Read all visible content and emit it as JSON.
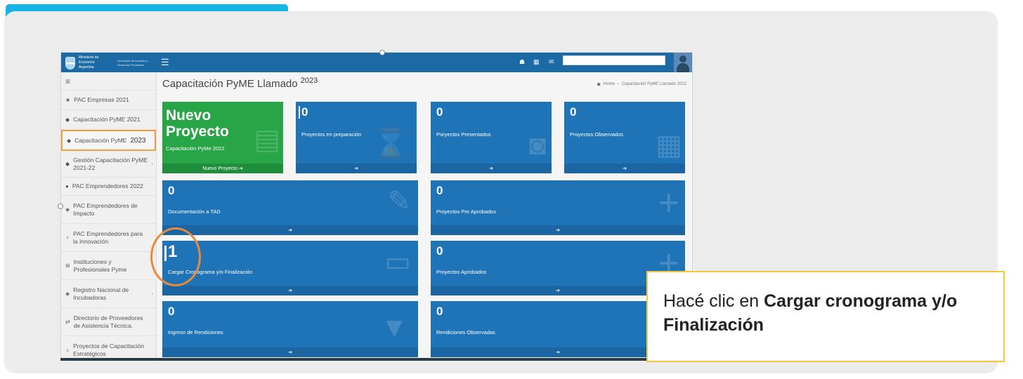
{
  "colors": {
    "accent": "#1ab3e6",
    "tile_blue": "#1f74b8",
    "tile_green": "#27a547",
    "highlight_orange": "#e88a3c",
    "callout_border": "#f4c541"
  },
  "topbar": {
    "brand_line1": "Ministerio de Economía Argentina",
    "brand_line2": "Secretaría de Industria y Desarrollo Productivo",
    "icons": [
      "home-icon",
      "grid-icon",
      "mail-icon"
    ]
  },
  "sidebar": {
    "toggle_icon": "≡",
    "items": [
      {
        "label": "PAC Empresas 2021",
        "icon": "★"
      },
      {
        "label": "Capacitación PyME 2021",
        "icon": "◆"
      },
      {
        "label": "Capacitación PyME",
        "year": "2023",
        "icon": "◆"
      },
      {
        "label": "Gestión Capacitación PyME 2021-22",
        "icon": "◆"
      },
      {
        "label": "PAC Emprendedores 2022",
        "icon": "●"
      },
      {
        "label": "PAC Emprendedores de Impacto",
        "icon": "◈"
      },
      {
        "label": "PAC Emprendedores para la Innovación",
        "icon": "♀"
      },
      {
        "label": "Instituciones y Profesionales Pyme",
        "icon": "⊖"
      },
      {
        "label": "Registro Nacional de Incubadoras",
        "icon": "◈"
      },
      {
        "label": "Directorio de Proveedores de Asistencia Técnica.",
        "icon": "⇄"
      },
      {
        "label": "Proyectos de Capacitación Estratégicos",
        "icon": "♀"
      }
    ]
  },
  "page": {
    "title": "Capacitación PyME Llamado",
    "title_year": "2023",
    "breadcrumb_home": "Home",
    "breadcrumb_current": "Capacitación PyME Llamado 2022"
  },
  "tiles": {
    "nuevo": {
      "line1": "Nuevo",
      "line2": "Proyecto",
      "sub": "Capacitación PyMe 2022",
      "footer": "Nuevo Proyecto"
    },
    "preparacion": {
      "count": "0",
      "label": "Proyectos en preparación"
    },
    "presentados": {
      "count": "0",
      "label": "Poryectos Presentados"
    },
    "observados": {
      "count": "0",
      "label": "Proyectos Observados"
    },
    "tad": {
      "count": "0",
      "label": "Documentación a TAD"
    },
    "pre_aprobados": {
      "count": "0",
      "label": "Proyectos Pre Aprobados"
    },
    "cronograma": {
      "count": "1",
      "label": "Cargar Cronograma y/o Finalización"
    },
    "aprobados": {
      "count": "0",
      "label": "Proyectos Aprobados"
    },
    "rendiciones": {
      "count": "0",
      "label": "Ingreso de Rendiciones"
    },
    "rend_observadas": {
      "count": "0",
      "label": "Rendiciones Observadas"
    }
  },
  "callout": {
    "text": "Hacé clic en",
    "bold": "Cargar cronograma y/o Finalización"
  }
}
